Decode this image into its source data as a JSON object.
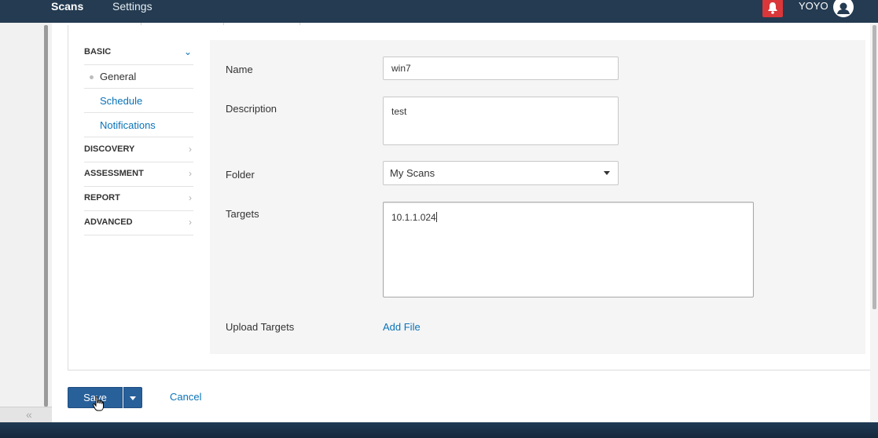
{
  "nav": {
    "scans": "Scans",
    "settings": "Settings",
    "username": "YOYO"
  },
  "sidebar": {
    "collapse_glyph": "«",
    "sections": [
      {
        "label": "BASIC",
        "expanded": true
      },
      {
        "label": "DISCOVERY",
        "expanded": false
      },
      {
        "label": "ASSESSMENT",
        "expanded": false
      },
      {
        "label": "REPORT",
        "expanded": false
      },
      {
        "label": "ADVANCED",
        "expanded": false
      }
    ],
    "basic_items": [
      {
        "label": "General",
        "active": true
      },
      {
        "label": "Schedule",
        "active": false
      },
      {
        "label": "Notifications",
        "active": false
      }
    ]
  },
  "form": {
    "name_label": "Name",
    "name_value": "win7",
    "description_label": "Description",
    "description_value": "test",
    "folder_label": "Folder",
    "folder_value": "My Scans",
    "targets_label": "Targets",
    "targets_value": "10.1.1.024",
    "upload_label": "Upload Targets",
    "add_file_label": "Add File"
  },
  "actions": {
    "save_label": "Save",
    "cancel_label": "Cancel"
  },
  "colors": {
    "nav_bg": "#243b51",
    "link": "#0a73b7",
    "primary_button": "#28609a",
    "alert": "#d9373a"
  }
}
